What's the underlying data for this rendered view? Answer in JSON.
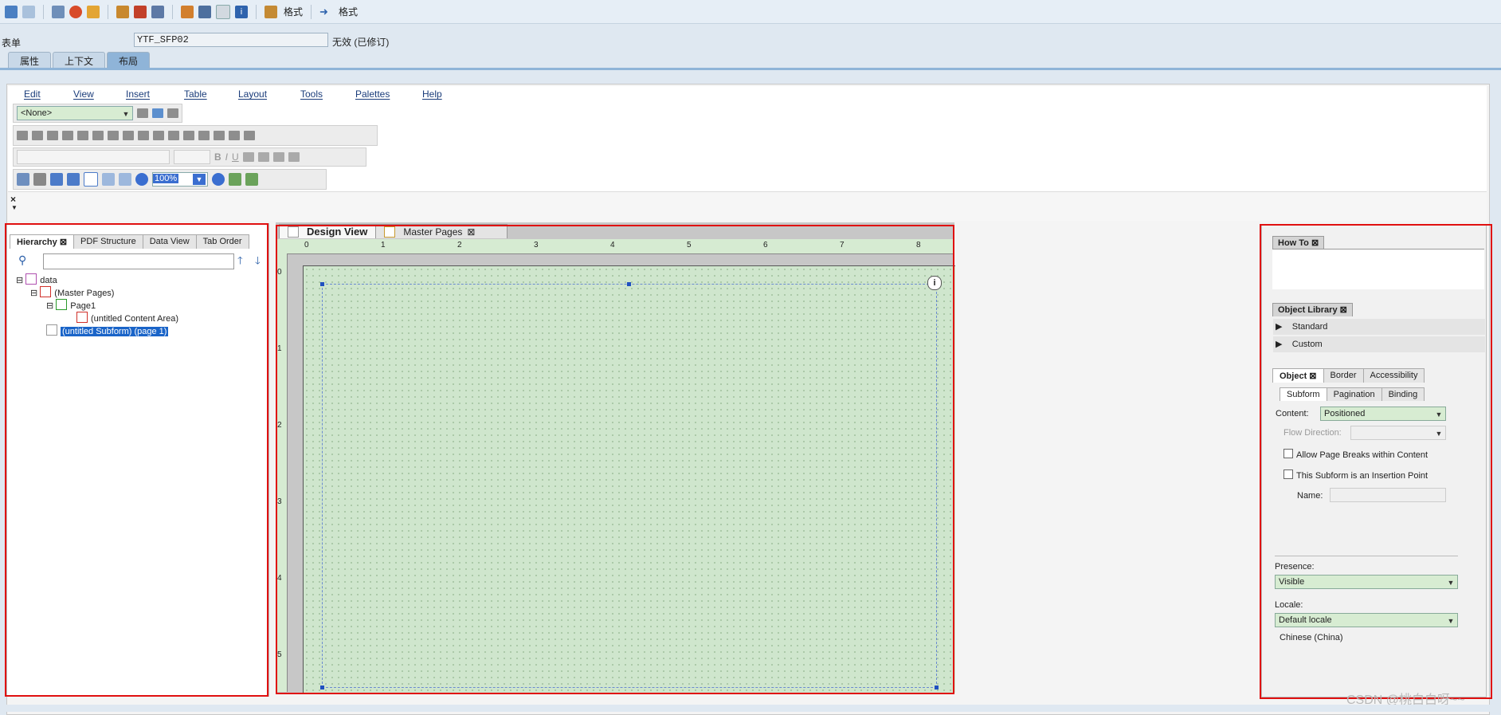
{
  "toolbar": {
    "items": [
      "back-icon",
      "forward-icon",
      "check-icon",
      "activate-icon",
      "object-icon",
      "hierarchy-icon",
      "pencil-icon",
      "layout-icon",
      "tree-icon",
      "align-icon",
      "frame-icon",
      "info-icon",
      "format-icon-1",
      "format-icon-2"
    ],
    "format1_label": "格式",
    "format2_label": "格式"
  },
  "form": {
    "label": "表单",
    "value": "YTF_SFP02",
    "status": "无效 (已修订)"
  },
  "tabs": [
    {
      "label": "属性"
    },
    {
      "label": "上下文"
    },
    {
      "label": "布局"
    }
  ],
  "designer": {
    "menu": [
      "Edit",
      "View",
      "Insert",
      "Table",
      "Layout",
      "Tools",
      "Palettes",
      "Help"
    ],
    "style_combo": "<None>",
    "zoom": "100%"
  },
  "hierarchy": {
    "tabs": [
      "Hierarchy",
      "PDF Structure",
      "Data View",
      "Tab Order"
    ],
    "tree": [
      {
        "label": "data",
        "level": 0
      },
      {
        "label": "(Master Pages)",
        "level": 1
      },
      {
        "label": "Page1",
        "level": 2
      },
      {
        "label": "(untitled Content Area)",
        "level": 3
      },
      {
        "label": "(untitled Subform) (page 1)",
        "level": 1,
        "selected": true
      }
    ]
  },
  "design": {
    "tabs": [
      "Design View",
      "Master Pages"
    ],
    "ruler_h": [
      "0",
      "1",
      "2",
      "3",
      "4",
      "5",
      "6",
      "7",
      "8"
    ],
    "ruler_v": [
      "0",
      "1",
      "2",
      "3",
      "4",
      "5"
    ]
  },
  "right": {
    "howto_title": "How To",
    "object_library_title": "Object Library",
    "library_items": [
      "Standard",
      "Custom"
    ],
    "object_tabs": [
      "Object",
      "Border",
      "Accessibility"
    ],
    "sub_tabs": [
      "Subform",
      "Pagination",
      "Binding"
    ],
    "content_label": "Content:",
    "content_value": "Positioned",
    "flow_direction_label": "Flow Direction:",
    "allow_page_breaks": "Allow Page Breaks within Content",
    "insertion_point": "This Subform is an Insertion Point",
    "name_label": "Name:",
    "presence_label": "Presence:",
    "presence_value": "Visible",
    "locale_label": "Locale:",
    "locale_value": "Default locale",
    "locale_detail": "Chinese (China)"
  },
  "watermark": "CSDN @桃白白呀~~",
  "colors": {
    "accent": "#8fb4d8",
    "highlight": "#e01010",
    "field_green": "#d7ecd2",
    "selection": "#1a64c8"
  }
}
